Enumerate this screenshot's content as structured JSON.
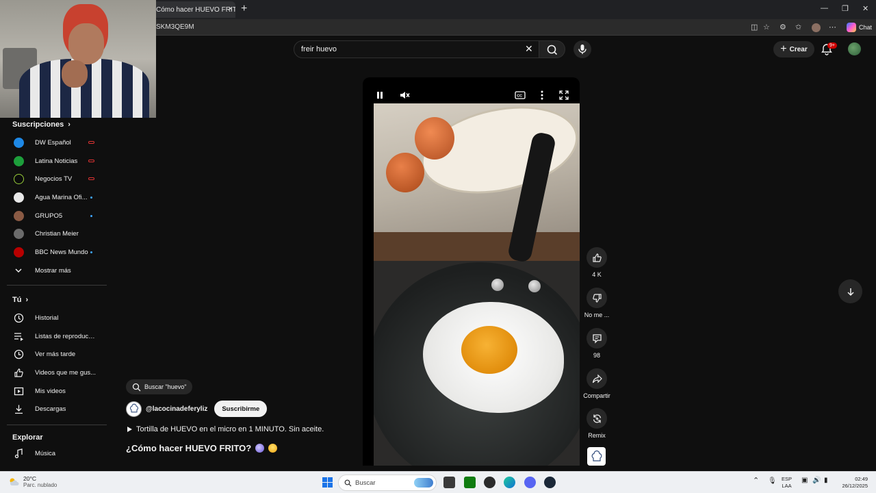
{
  "browser": {
    "tab_title": "Cómo hacer HUEVO FRITO?",
    "tab_close": "×",
    "new_tab": "+",
    "url_fragment": "SKM3QE9M",
    "chat_label": "Chat"
  },
  "header": {
    "search_query": "freir huevo",
    "create_label": "Crear",
    "notifications_badge": "9+"
  },
  "sidebar": {
    "subscriptions_title": "Suscripciones",
    "subscriptions": [
      {
        "label": "DW Español",
        "color": "#1e88e5",
        "status": "live"
      },
      {
        "label": "Latina Noticias",
        "color": "#1d9e3b",
        "status": "live"
      },
      {
        "label": "Negocios TV",
        "color": "#0b0b0b",
        "status": "live"
      },
      {
        "label": "Agua Marina Ofi...",
        "color": "#e8e8e8",
        "status": "new"
      },
      {
        "label": "GRUPO5",
        "color": "#8a5a44",
        "status": "new"
      },
      {
        "label": "Christian Meier",
        "color": "#6b6b6b",
        "status": "none"
      },
      {
        "label": "BBC News Mundo",
        "color": "#b80000",
        "status": "new"
      }
    ],
    "show_more": "Mostrar más",
    "you_title": "Tú",
    "you_items": [
      {
        "label": "Historial",
        "icon": "history-icon"
      },
      {
        "label": "Listas de reproducc...",
        "icon": "playlists-icon"
      },
      {
        "label": "Ver más tarde",
        "icon": "clock-icon"
      },
      {
        "label": "Videos que me gus...",
        "icon": "thumb-up-icon"
      },
      {
        "label": "Mis videos",
        "icon": "play-square-icon"
      },
      {
        "label": "Descargas",
        "icon": "download-icon"
      }
    ],
    "explore_title": "Explorar",
    "explore_items": [
      {
        "label": "Música",
        "icon": "music-note-icon"
      }
    ]
  },
  "actions": {
    "likes": "4 K",
    "dislike": "No me ...",
    "comments": "98",
    "share": "Compartir",
    "remix": "Remix"
  },
  "video": {
    "search_chip": "Buscar \"huevo\"",
    "channel": "@lacocinadeferyliz",
    "subscribe": "Suscribirme",
    "playlist_line": "Tortilla de HUEVO en el micro en 1 MINUTO. Sin aceite.",
    "title": "¿Cómo hacer HUEVO FRITO?"
  },
  "taskbar": {
    "temperature": "20°C",
    "weather": "Parc. nublado",
    "search_label": "Buscar",
    "lang_top": "ESP",
    "lang_bottom": "LAA",
    "time": "02:49",
    "date": "26/12/2025"
  }
}
